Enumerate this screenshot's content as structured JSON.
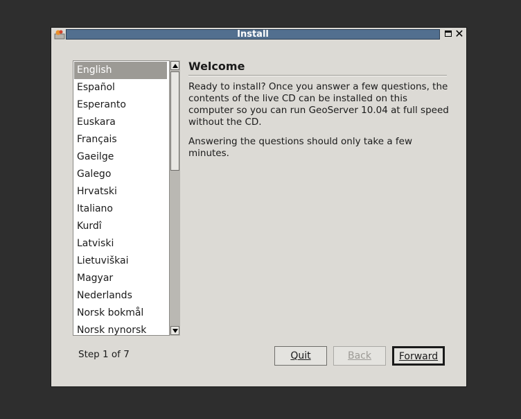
{
  "window": {
    "title": "Install"
  },
  "languages": {
    "items": [
      "English",
      "Español",
      "Esperanto",
      "Euskara",
      "Français",
      "Gaeilge",
      "Galego",
      "Hrvatski",
      "Italiano",
      "Kurdî",
      "Latviski",
      "Lietuviškai",
      "Magyar",
      "Nederlands",
      "Norsk bokmål",
      "Norsk nynorsk"
    ],
    "selected": "English"
  },
  "welcome": {
    "heading": "Welcome",
    "paragraph1": "Ready to install?  Once you answer a few questions, the contents of the live CD can be installed on this computer so you can run GeoServer 10.04 at full speed without the CD.",
    "paragraph2": "Answering the questions should only take a few minutes."
  },
  "footer": {
    "step": "Step 1 of 7",
    "quit_label": "Quit",
    "back_label": "Back",
    "forward_label": "Forward"
  },
  "icons": {
    "app": "installer-icon",
    "maximize": "maximize-icon",
    "close": "close-icon",
    "scroll_up": "arrow-up-icon",
    "scroll_down": "arrow-down-icon"
  },
  "colors": {
    "titlebar": "#526f8f",
    "selection": "#9c9a95",
    "window_bg": "#dcdad5"
  }
}
